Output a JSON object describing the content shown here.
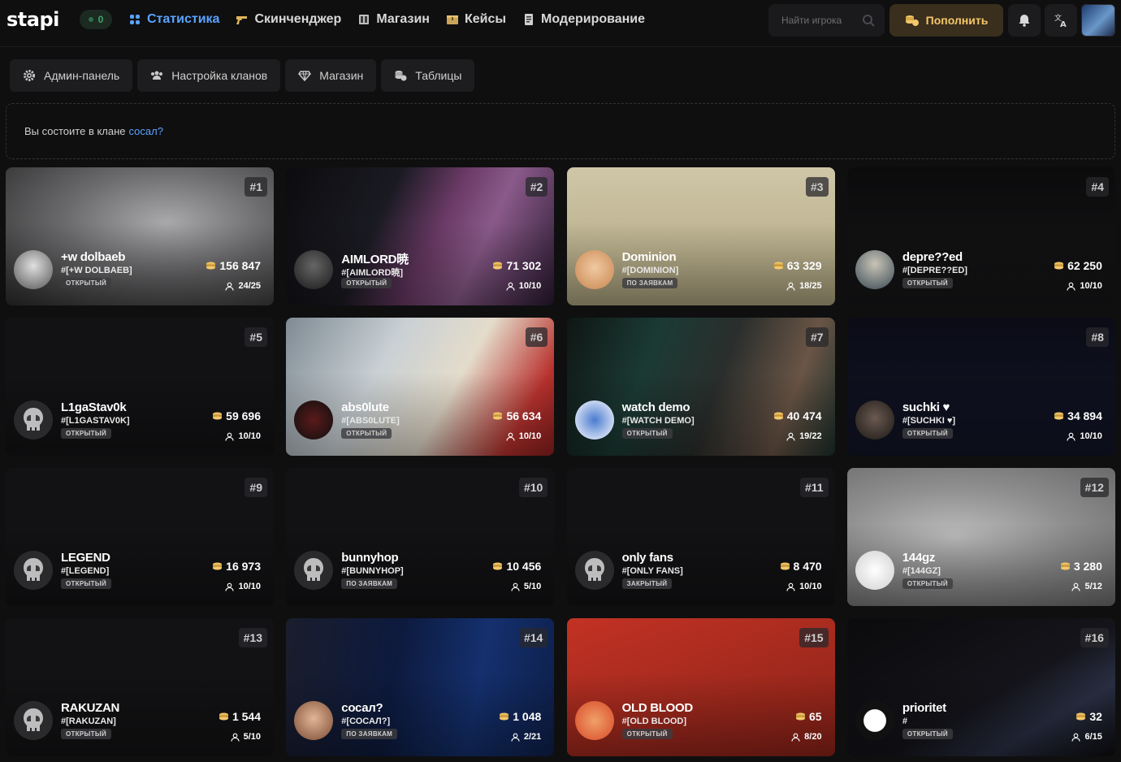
{
  "header": {
    "logo": "stapi",
    "online_count": "0",
    "nav": [
      {
        "label": "Статистика",
        "icon": "stats-icon",
        "active": true
      },
      {
        "label": "Скинченджер",
        "icon": "gun-icon",
        "active": false
      },
      {
        "label": "Магазин",
        "icon": "shop-icon",
        "active": false
      },
      {
        "label": "Кейсы",
        "icon": "case-icon",
        "active": false
      },
      {
        "label": "Модерирование",
        "icon": "moderation-icon",
        "active": false
      }
    ],
    "search_placeholder": "Найти игрока",
    "topup_label": "Пополнить"
  },
  "subtabs": [
    {
      "label": "Админ-панель",
      "icon": "gear-icon"
    },
    {
      "label": "Настройка кланов",
      "icon": "users-icon"
    },
    {
      "label": "Магазин",
      "icon": "diamond-icon"
    },
    {
      "label": "Таблицы",
      "icon": "coins-icon"
    }
  ],
  "notice": {
    "text": "Вы состоите в клане",
    "clan_link": "сосал?"
  },
  "colors": {
    "accent": "#5aa3ff",
    "gold": "#f3c86a",
    "bg": "#0f0f10"
  },
  "clans": [
    {
      "rank": "#1",
      "name": "+w dolbaeb",
      "tag": "#[+W DOLBAEB]",
      "type": "ОТКРЫТЫЙ",
      "score": "156 847",
      "members": "24/25"
    },
    {
      "rank": "#2",
      "name": "AIMLORD暁",
      "tag": "#[AIMLORD暁]",
      "type": "ОТКРЫТЫЙ",
      "score": "71 302",
      "members": "10/10"
    },
    {
      "rank": "#3",
      "name": "Dominion",
      "tag": "#[DOMINION]",
      "type": "ПО ЗАЯВКАМ",
      "score": "63 329",
      "members": "18/25"
    },
    {
      "rank": "#4",
      "name": "depre??ed",
      "tag": "#[DEPRE??ED]",
      "type": "ОТКРЫТЫЙ",
      "score": "62 250",
      "members": "10/10"
    },
    {
      "rank": "#5",
      "name": "L1gaStav0k",
      "tag": "#[L1GASTAV0K]",
      "type": "ОТКРЫТЫЙ",
      "score": "59 696",
      "members": "10/10"
    },
    {
      "rank": "#6",
      "name": "abs0lute",
      "tag": "#[ABS0LUTE]",
      "type": "ОТКРЫТЫЙ",
      "score": "56 634",
      "members": "10/10"
    },
    {
      "rank": "#7",
      "name": "watch demo",
      "tag": "#[WATCH DEMO]",
      "type": "ОТКРЫТЫЙ",
      "score": "40 474",
      "members": "19/22"
    },
    {
      "rank": "#8",
      "name": "suchki ♥",
      "tag": "#[SUCHKI ♥]",
      "type": "ОТКРЫТЫЙ",
      "score": "34 894",
      "members": "10/10"
    },
    {
      "rank": "#9",
      "name": "LEGEND",
      "tag": "#[LEGEND]",
      "type": "ОТКРЫТЫЙ",
      "score": "16 973",
      "members": "10/10"
    },
    {
      "rank": "#10",
      "name": "bunnyhop",
      "tag": "#[BUNNYHOP]",
      "type": "ПО ЗАЯВКАМ",
      "score": "10 456",
      "members": "5/10"
    },
    {
      "rank": "#11",
      "name": "only fans",
      "tag": "#[ONLY FANS]",
      "type": "ЗАКРЫТЫЙ",
      "score": "8 470",
      "members": "10/10"
    },
    {
      "rank": "#12",
      "name": "144gz",
      "tag": "#[144GZ]",
      "type": "ОТКРЫТЫЙ",
      "score": "3 280",
      "members": "5/12"
    },
    {
      "rank": "#13",
      "name": "RAKUZAN",
      "tag": "#[RAKUZAN]",
      "type": "ОТКРЫТЫЙ",
      "score": "1 544",
      "members": "5/10"
    },
    {
      "rank": "#14",
      "name": "сосал?",
      "tag": "#[СОСАЛ?]",
      "type": "ПО ЗАЯВКАМ",
      "score": "1 048",
      "members": "2/21"
    },
    {
      "rank": "#15",
      "name": "OLD BLOOD",
      "tag": "#[OLD BLOOD]",
      "type": "ОТКРЫТЫЙ",
      "score": "65",
      "members": "8/20"
    },
    {
      "rank": "#16",
      "name": "prioritet",
      "tag": "#",
      "type": "ОТКРЫТЫЙ",
      "score": "32",
      "members": "6/15"
    }
  ]
}
